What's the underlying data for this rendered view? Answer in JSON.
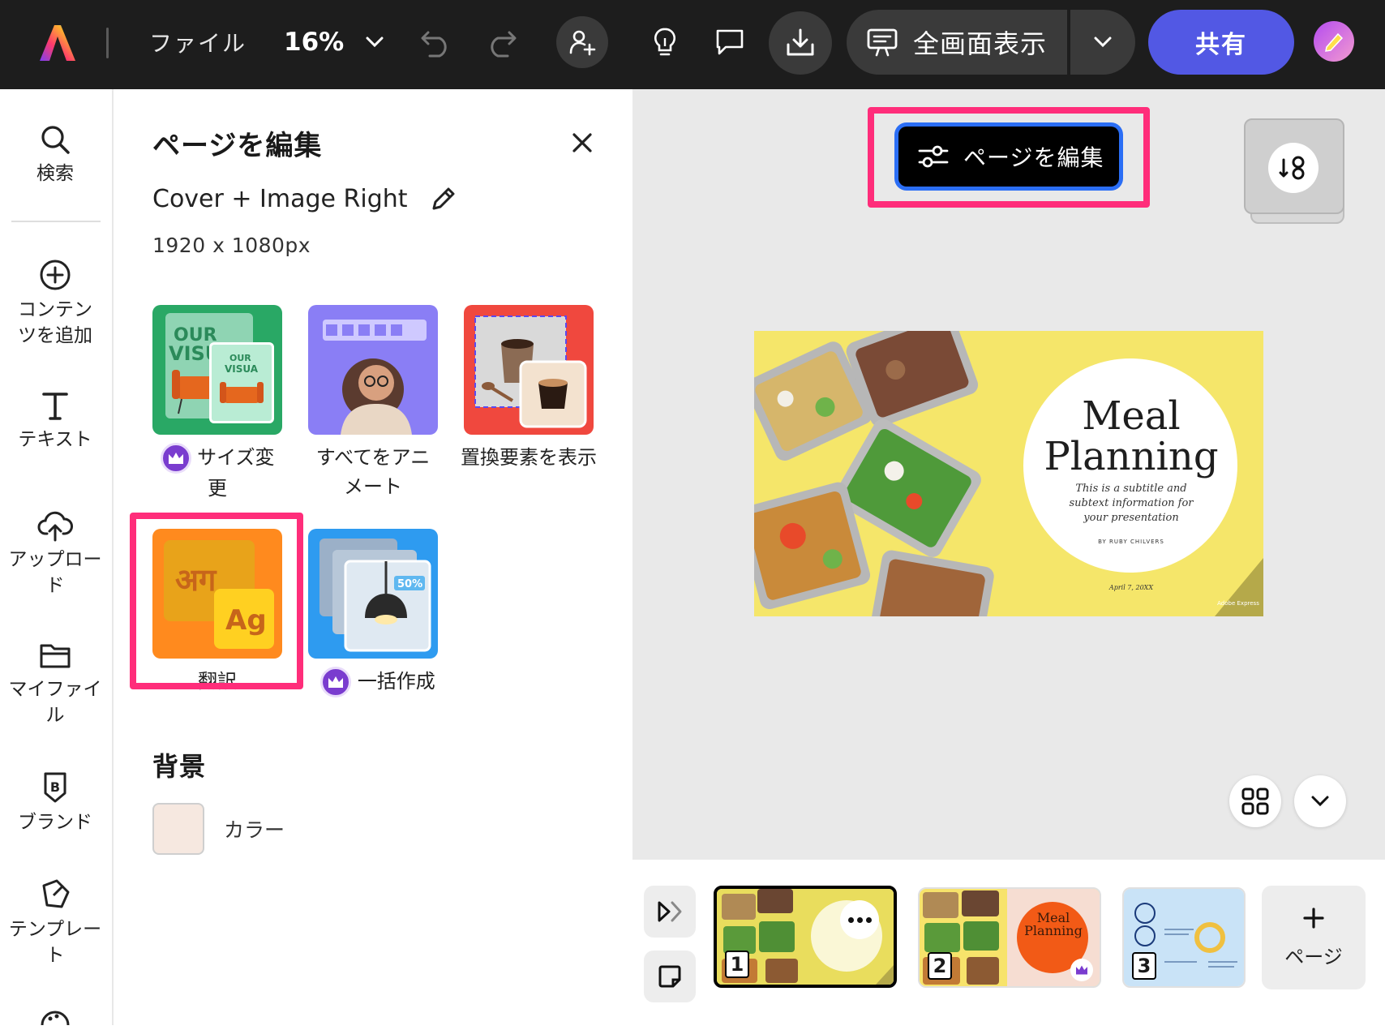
{
  "topbar": {
    "file_label": "ファイル",
    "zoom": "16%",
    "present_label": "全画面表示",
    "share_label": "共有"
  },
  "rail": {
    "search": "検索",
    "add_content": "コンテンツを追加",
    "text": "テキスト",
    "upload": "アップロード",
    "my_files": "マイファイル",
    "brand": "ブランド",
    "templates": "テンプレート"
  },
  "panel": {
    "title": "ページを編集",
    "template_name": "Cover + Image Right",
    "size": "1920 x 1080px",
    "tools": [
      {
        "label": "サイズ変更",
        "premium": true
      },
      {
        "label": "すべてをアニメート",
        "premium": false
      },
      {
        "label": "置換要素を表示",
        "premium": false
      },
      {
        "label": "翻訳",
        "premium": false
      },
      {
        "label": "一括作成",
        "premium": true
      }
    ],
    "background_heading": "背景",
    "color_label": "カラー",
    "color_value": "#f6e8e0"
  },
  "canvas": {
    "edit_page_label": "ページを編集",
    "slide": {
      "title_line1": "Meal",
      "title_line2": "Planning",
      "subtitle": "This is a subtitle and subtext information for your presentation",
      "author": "BY RUBY CHILVERS",
      "date": "April 7, 20XX",
      "watermark": "Adobe Express"
    }
  },
  "pages": {
    "numbers": [
      "1",
      "2",
      "3"
    ],
    "add_page_label": "ページ",
    "thumb2_title": "Meal Planning"
  },
  "colors": {
    "highlight": "#ff2d7a",
    "share": "#5258e4",
    "topbar": "#1d1d1d"
  }
}
